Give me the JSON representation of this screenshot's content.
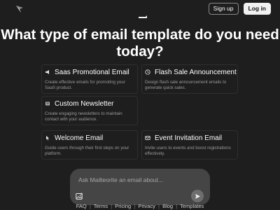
{
  "header": {
    "signup_label": "Sign up",
    "login_label": "Log in"
  },
  "headline": "What type of email template do you need today?",
  "cards": [
    {
      "title": "Saas Promotional Email",
      "description": "Create effective emails for promoting your SaaS product.",
      "icon": "megaphone-icon"
    },
    {
      "title": "Flash Sale Announcement",
      "description": "Design flash sale announcement emails to generate quick sales.",
      "icon": "clock-icon"
    },
    {
      "title": "Custom Newsletter",
      "description": "Create engaging newsletters to maintain contact with your audience.",
      "icon": "newspaper-icon"
    },
    {
      "title": "Welcome Email",
      "description": "Guide users through their first steps on your platform.",
      "icon": "pointer-icon"
    },
    {
      "title": "Event Invitation Email",
      "description": "Invite users to events and boost registrations effectively.",
      "icon": "envelope-icon"
    }
  ],
  "composer": {
    "placeholder": "Ask Mailteorite an email about...",
    "value": ""
  },
  "footer": {
    "links": [
      "FAQ",
      "Terms",
      "Pricing",
      "Privacy",
      "Blog",
      "Templates"
    ],
    "separator": "|"
  },
  "colors": {
    "background": "#1e1e1e",
    "card_border": "#2e2e2e",
    "composer_bg": "#454545",
    "login_bg": "#f0f0f0"
  }
}
